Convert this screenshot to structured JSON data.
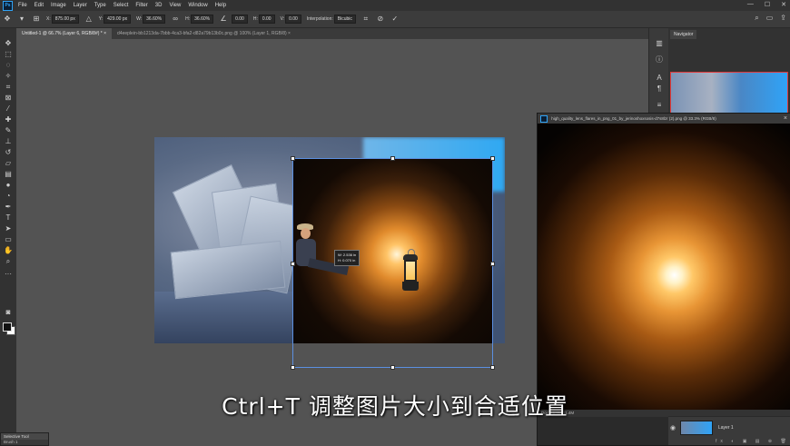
{
  "app": {
    "logo": "Ps"
  },
  "menu": [
    "File",
    "Edit",
    "Image",
    "Layer",
    "Type",
    "Select",
    "Filter",
    "3D",
    "View",
    "Window",
    "Help"
  ],
  "window_controls": [
    "—",
    "☐",
    "✕"
  ],
  "options_bar": {
    "x_label": "X:",
    "x_value": "875.00 px",
    "y_label": "Y:",
    "y_value": "429.00 px",
    "w_label": "W:",
    "w_value": "36.60%",
    "h_label": "H:",
    "h_value": "36.60%",
    "angle_value": "0.00",
    "hskew_label": "H:",
    "hskew_value": "0.00",
    "vskew_label": "V:",
    "vskew_value": "0.00",
    "interp_label": "Interpolation:",
    "interp_value": "Bicubic"
  },
  "tabs": [
    {
      "label": "Untitled-1 @ 66.7% (Layer 6, RGB/8#) *",
      "active": true
    },
    {
      "label": "d4eeplein-bb1213da-7bbb-4ca3-bfa2-d82a79b13b0c.png @ 100% (Layer 1, RGB/8)",
      "active": false
    }
  ],
  "tab_close": "×",
  "tooltip": {
    "line1": "W: 2.536 in",
    "line2": "H: 0.070 in"
  },
  "float_window": {
    "title": "high_quality_lens_flares_in_png_01_by_jerinoshoxsosis-d7s8lzr (2).png @ 33.3% (RGB/8)",
    "close": "×",
    "status": "Doc: 11.4M/11.4M"
  },
  "navigator": {
    "title": "Navigator"
  },
  "layers": {
    "eye": "◉",
    "layer_name": "Layer 1",
    "footer_icons": "fx ◐ ▣ ▤ ⊕ 🗑"
  },
  "mini_panel": {
    "title": "Selective Tool",
    "value": "Brush 1"
  },
  "subtitle": "Ctrl+T 调整图片大小到合适位置",
  "icons": [
    "move-icon",
    "marquee-icon",
    "lasso-icon",
    "magic-wand-icon",
    "crop-icon",
    "frame-icon",
    "eyedropper-icon",
    "healing-icon",
    "brush-icon",
    "stamp-icon",
    "history-brush-icon",
    "eraser-icon",
    "gradient-icon",
    "blur-icon",
    "dodge-icon",
    "pen-icon",
    "type-icon",
    "path-select-icon",
    "shape-icon",
    "hand-icon",
    "zoom-icon",
    "more-icon"
  ]
}
